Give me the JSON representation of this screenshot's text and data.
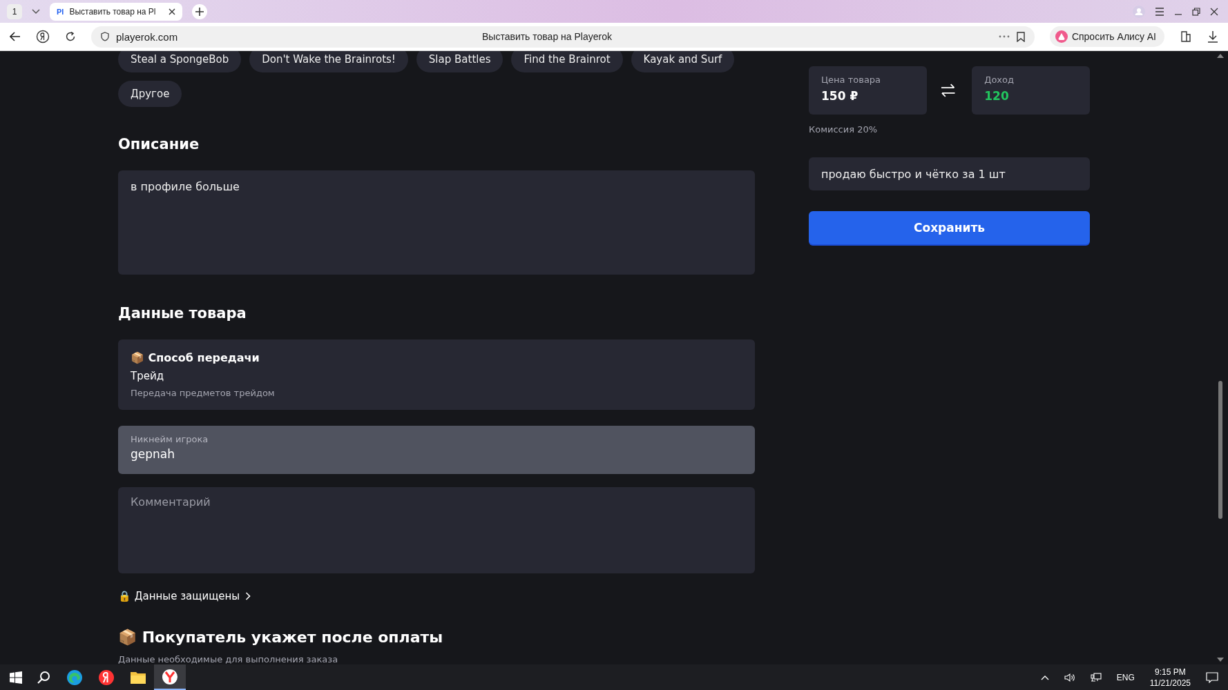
{
  "browser": {
    "tab_count": "1",
    "tabs": [
      {
        "favicon": "Pl",
        "title": "Выставить товар на Pl",
        "selected": true
      }
    ],
    "url": "playerok.com",
    "page_title": "Выставить товар на Playerok",
    "alice_button": "Спросить Алису AI"
  },
  "games": [
    {
      "label": "Steal a SpongeBob",
      "selected": false
    },
    {
      "label": "Don't Wake the Brainrots!",
      "selected": false
    },
    {
      "label": "Slap Battles",
      "selected": false
    },
    {
      "label": "Find the Brainrot",
      "selected": false
    },
    {
      "label": "Kayak and Surf",
      "selected": false
    },
    {
      "label": "Другое",
      "selected": false
    }
  ],
  "description": {
    "heading": "Описание",
    "value": "в профиле больше"
  },
  "item_data": {
    "heading": "Данные товара",
    "transfer": {
      "emoji": "📦",
      "title": "Способ передачи",
      "value": "Трейд",
      "hint": "Передача предметов трейдом"
    },
    "nickname": {
      "label": "Никнейм игрока",
      "value": "gepnah",
      "focused": true
    },
    "comment": {
      "placeholder": "Комментарий"
    },
    "protected_link": {
      "emoji": "🔒",
      "label": "Данные защищены"
    }
  },
  "buyer_section": {
    "emoji": "📦",
    "heading": "Покупатель укажет после оплаты",
    "subtitle": "Данные необходимые для выполнения заказа"
  },
  "pricing": {
    "price_label": "Цена товара",
    "price": "150 ₽",
    "income_label": "Доход",
    "income": "120",
    "commission": "Комиссия 20%"
  },
  "short_text": {
    "value": "продаю быстро и чётко за 1 шт"
  },
  "save_button": "Сохранить",
  "taskbar": {
    "apps": [
      {
        "kind": "edge",
        "selected": false
      },
      {
        "kind": "yandex",
        "selected": false
      },
      {
        "kind": "explorer",
        "selected": false
      },
      {
        "kind": "ybrowser",
        "selected": true
      }
    ],
    "language": "ENG",
    "time": "9:15 PM",
    "date": "11/21/2025"
  }
}
